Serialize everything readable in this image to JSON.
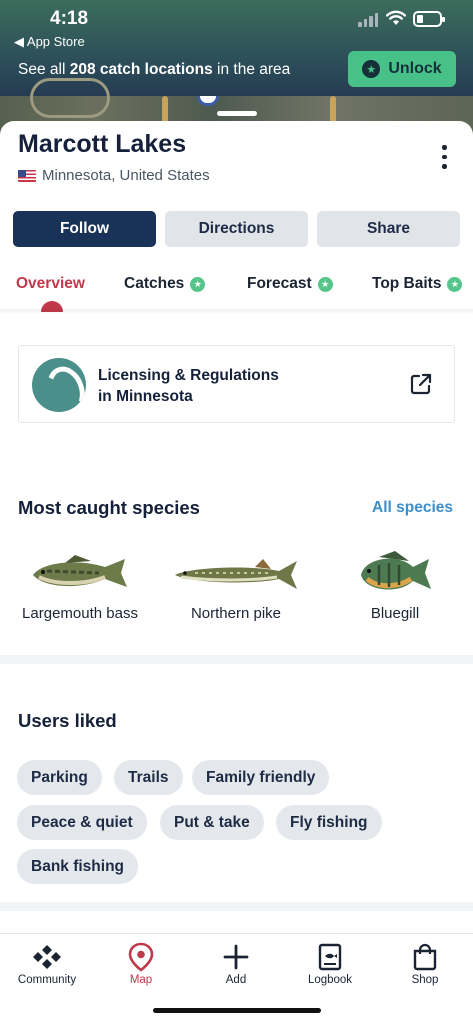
{
  "status_bar": {
    "time": "4:18",
    "back_app": "◀ App Store"
  },
  "banner": {
    "text_prefix": "See all ",
    "text_bold": "208 catch locations",
    "text_suffix": " in the area",
    "unlock_label": "Unlock"
  },
  "location": {
    "title": "Marcott Lakes",
    "region": "Minnesota, United States"
  },
  "actions": {
    "follow": "Follow",
    "directions": "Directions",
    "share": "Share"
  },
  "tabs": [
    {
      "label": "Overview"
    },
    {
      "label": "Catches"
    },
    {
      "label": "Forecast"
    },
    {
      "label": "Top Baits"
    }
  ],
  "licensing": {
    "line1": "Licensing & Regulations",
    "line2": "in Minnesota"
  },
  "species": {
    "title": "Most caught species",
    "all_link": "All species",
    "items": [
      {
        "name": "Largemouth bass"
      },
      {
        "name": "Northern pike"
      },
      {
        "name": "Bluegill"
      }
    ]
  },
  "users_liked": {
    "title": "Users liked",
    "tags": [
      "Parking",
      "Trails",
      "Family friendly",
      "Peace & quiet",
      "Put & take",
      "Fly fishing",
      "Bank fishing"
    ]
  },
  "nav": {
    "items": [
      {
        "label": "Community",
        "icon": "community-icon"
      },
      {
        "label": "Map",
        "icon": "map-pin-icon"
      },
      {
        "label": "Add",
        "icon": "plus-icon"
      },
      {
        "label": "Logbook",
        "icon": "logbook-icon"
      },
      {
        "label": "Shop",
        "icon": "shopping-bag-icon"
      }
    ]
  },
  "colors": {
    "accent_red": "#c0394a",
    "navy": "#183258",
    "green": "#48c189",
    "link_blue": "#3d8ec9"
  }
}
